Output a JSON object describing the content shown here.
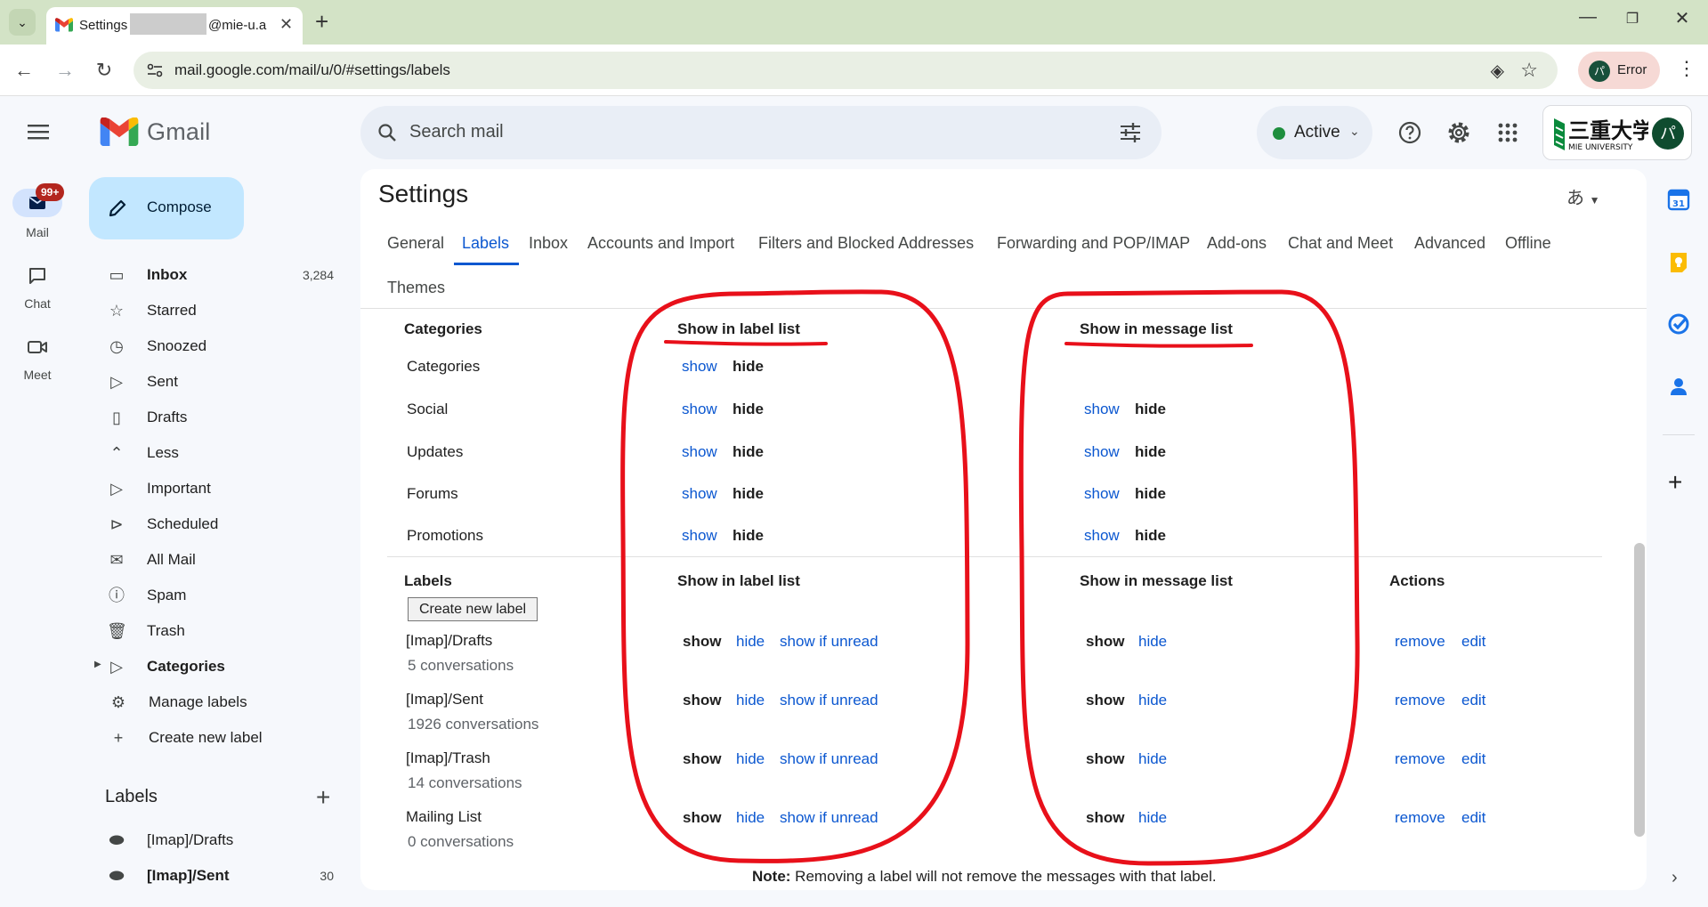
{
  "browser": {
    "tab_title": "Settings",
    "tab_domain": "@mie-u.a",
    "url": "mail.google.com/mail/u/0/#settings/labels",
    "profile_label": "Error",
    "profile_initial": "パ"
  },
  "header": {
    "app_name": "Gmail",
    "search_placeholder": "Search mail",
    "status_label": "Active",
    "status_color": "#1e8e3e",
    "account_initial": "パ"
  },
  "rail": {
    "badge": "99+",
    "items": [
      "Mail",
      "Chat",
      "Meet"
    ]
  },
  "sidebar": {
    "compose_label": "Compose",
    "items": [
      {
        "label": "Inbox",
        "count": "3,284",
        "icon": "inbox-icon"
      },
      {
        "label": "Starred",
        "icon": "star-icon"
      },
      {
        "label": "Snoozed",
        "icon": "clock-icon"
      },
      {
        "label": "Sent",
        "icon": "send-icon"
      },
      {
        "label": "Drafts",
        "icon": "draft-icon"
      },
      {
        "label": "Less",
        "icon": "chevron-up-icon"
      },
      {
        "label": "Important",
        "icon": "important-icon"
      },
      {
        "label": "Scheduled",
        "icon": "scheduled-icon"
      },
      {
        "label": "All Mail",
        "icon": "all-mail-icon"
      },
      {
        "label": "Spam",
        "icon": "spam-icon"
      },
      {
        "label": "Trash",
        "icon": "trash-icon"
      },
      {
        "label": "Categories",
        "icon": "label-icon"
      },
      {
        "label": "Manage labels",
        "icon": "gear-icon"
      },
      {
        "label": "Create new label",
        "icon": "plus-icon"
      }
    ],
    "labels_heading": "Labels",
    "labels": [
      {
        "label": "[Imap]/Drafts"
      },
      {
        "label": "[Imap]/Sent",
        "count": "30"
      }
    ]
  },
  "settings": {
    "title": "Settings",
    "ime_label": "あ",
    "tabs": [
      "General",
      "Labels",
      "Inbox",
      "Accounts and Import",
      "Filters and Blocked Addresses",
      "Forwarding and POP/IMAP",
      "Add-ons",
      "Chat and Meet",
      "Advanced",
      "Offline",
      "Themes"
    ],
    "selected_tab": "Labels",
    "categories_section": {
      "heading": "Categories",
      "col_label_list": "Show in label list",
      "col_message_list": "Show in message list",
      "rows": [
        "Categories",
        "Social",
        "Updates",
        "Forums",
        "Promotions"
      ]
    },
    "labels_section": {
      "heading": "Labels",
      "create_button": "Create new label",
      "col_label_list": "Show in label list",
      "col_message_list": "Show in message list",
      "col_actions": "Actions",
      "rows": [
        {
          "name": "[Imap]/Drafts",
          "sub": "5 conversations"
        },
        {
          "name": "[Imap]/Sent",
          "sub": "1926 conversations"
        },
        {
          "name": "[Imap]/Trash",
          "sub": "14 conversations"
        },
        {
          "name": "Mailing List",
          "sub": "0 conversations"
        }
      ]
    },
    "link_show": "show",
    "link_hide": "hide",
    "link_show_if_unread": "show if unread",
    "link_remove": "remove",
    "link_edit": "edit",
    "note_bold": "Note:",
    "note_text": " Removing a label will not remove the messages with that label."
  },
  "annotation_color": "#e8101a"
}
